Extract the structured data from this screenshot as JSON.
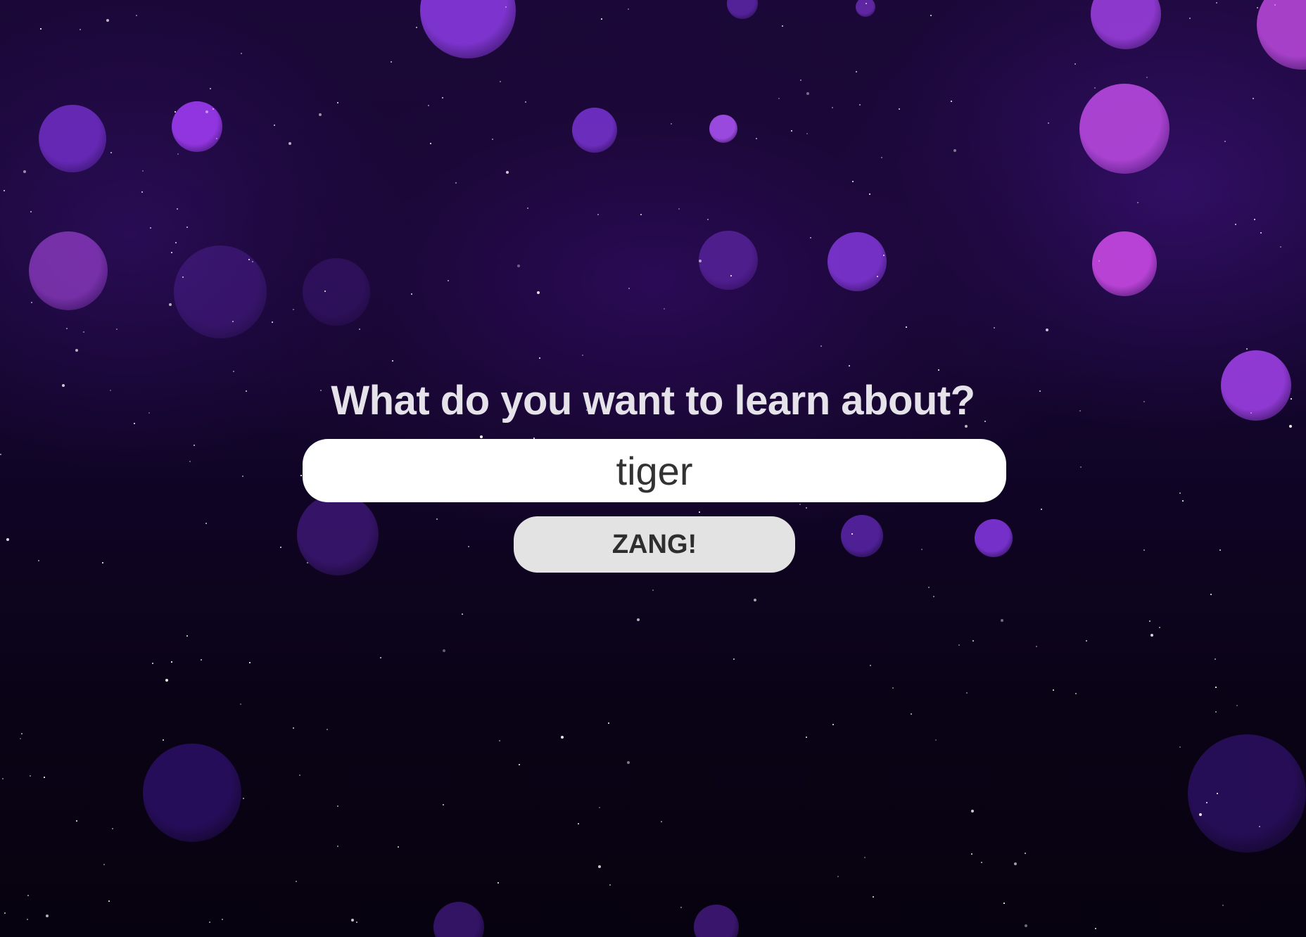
{
  "prompt": {
    "heading": "What do you want to learn about?"
  },
  "search": {
    "value": "tiger"
  },
  "actions": {
    "submit_label": "ZANG!"
  },
  "theme": {
    "background": "#12052a",
    "bokeh_purple": "#8a2be2",
    "bokeh_magenta": "#c23be8",
    "heading_color": "#e6e2ea",
    "input_background": "#ffffff",
    "button_background": "#e3e3e3"
  }
}
